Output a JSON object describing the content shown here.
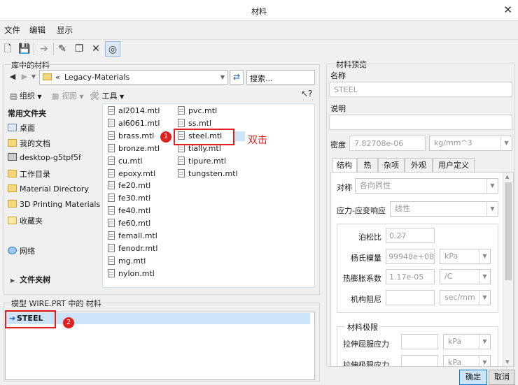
{
  "window": {
    "title": "材料",
    "close_glyph": "✕"
  },
  "menu": [
    "文件",
    "编辑",
    "显示"
  ],
  "library": {
    "group_label": "库中的材料",
    "path": "Legacy-Materials",
    "path_prefix": "«",
    "search_placeholder": "搜索...",
    "organize": "组织",
    "views": "视图",
    "tools": "工具",
    "favorites_title": "常用文件夹",
    "nav": [
      "桌面",
      "我的文档",
      "desktop-g5tpf5f",
      "工作目录",
      "Material Directory",
      "3D Printing Materials",
      "收藏夹",
      "网络"
    ],
    "folder_tree": "文件夹树",
    "files_col1": [
      "al2014.mtl",
      "al6061.mtl",
      "brass.mtl",
      "bronze.mtl",
      "cu.mtl",
      "epoxy.mtl",
      "fe20.mtl",
      "fe30.mtl",
      "fe40.mtl",
      "fe60.mtl",
      "femall.mtl",
      "fenodr.mtl",
      "mg.mtl",
      "nylon.mtl"
    ],
    "files_col2": [
      "pvc.mtl",
      "ss.mtl",
      "steel.mtl",
      "tially.mtl",
      "tipure.mtl",
      "tungsten.mtl"
    ]
  },
  "annotation": {
    "badge1": "1",
    "badge2": "2",
    "double_click": "双击"
  },
  "model": {
    "group_label": "模型 WIRE.PRT 中的 材料",
    "items": [
      "STEEL"
    ]
  },
  "preview": {
    "group_label": "材料预览",
    "name_label": "名称",
    "name_value": "STEEL",
    "desc_label": "说明",
    "density_label": "密度",
    "density_value": "7.82708e-06",
    "density_unit": "kg/mm^3",
    "tabs": [
      "结构",
      "热",
      "杂项",
      "外观",
      "用户定义"
    ],
    "symmetry_label": "对称",
    "symmetry_value": "各向同性",
    "stress_label": "应力-应变响应",
    "stress_value": "线性",
    "poisson_label": "泊松比",
    "poisson_value": "0.27",
    "young_label": "杨氏模量",
    "young_value": "99948e+08",
    "young_unit": "kPa",
    "thermal_label": "热膨胀系数",
    "thermal_value": "1.17e-05",
    "thermal_unit": "/C",
    "damping_label": "机构阻尼",
    "damping_unit": "sec/mm",
    "limits_label": "材料极限",
    "tensile_yield_label": "拉伸屈服应力",
    "tensile_yield_unit": "kPa",
    "tensile_ult_label": "拉伸极限应力",
    "tensile_ult_unit": "kPa"
  },
  "buttons": {
    "ok": "确定",
    "cancel": "取消"
  },
  "colors": {
    "accent": "#e02020",
    "selection": "#cce4f7"
  }
}
